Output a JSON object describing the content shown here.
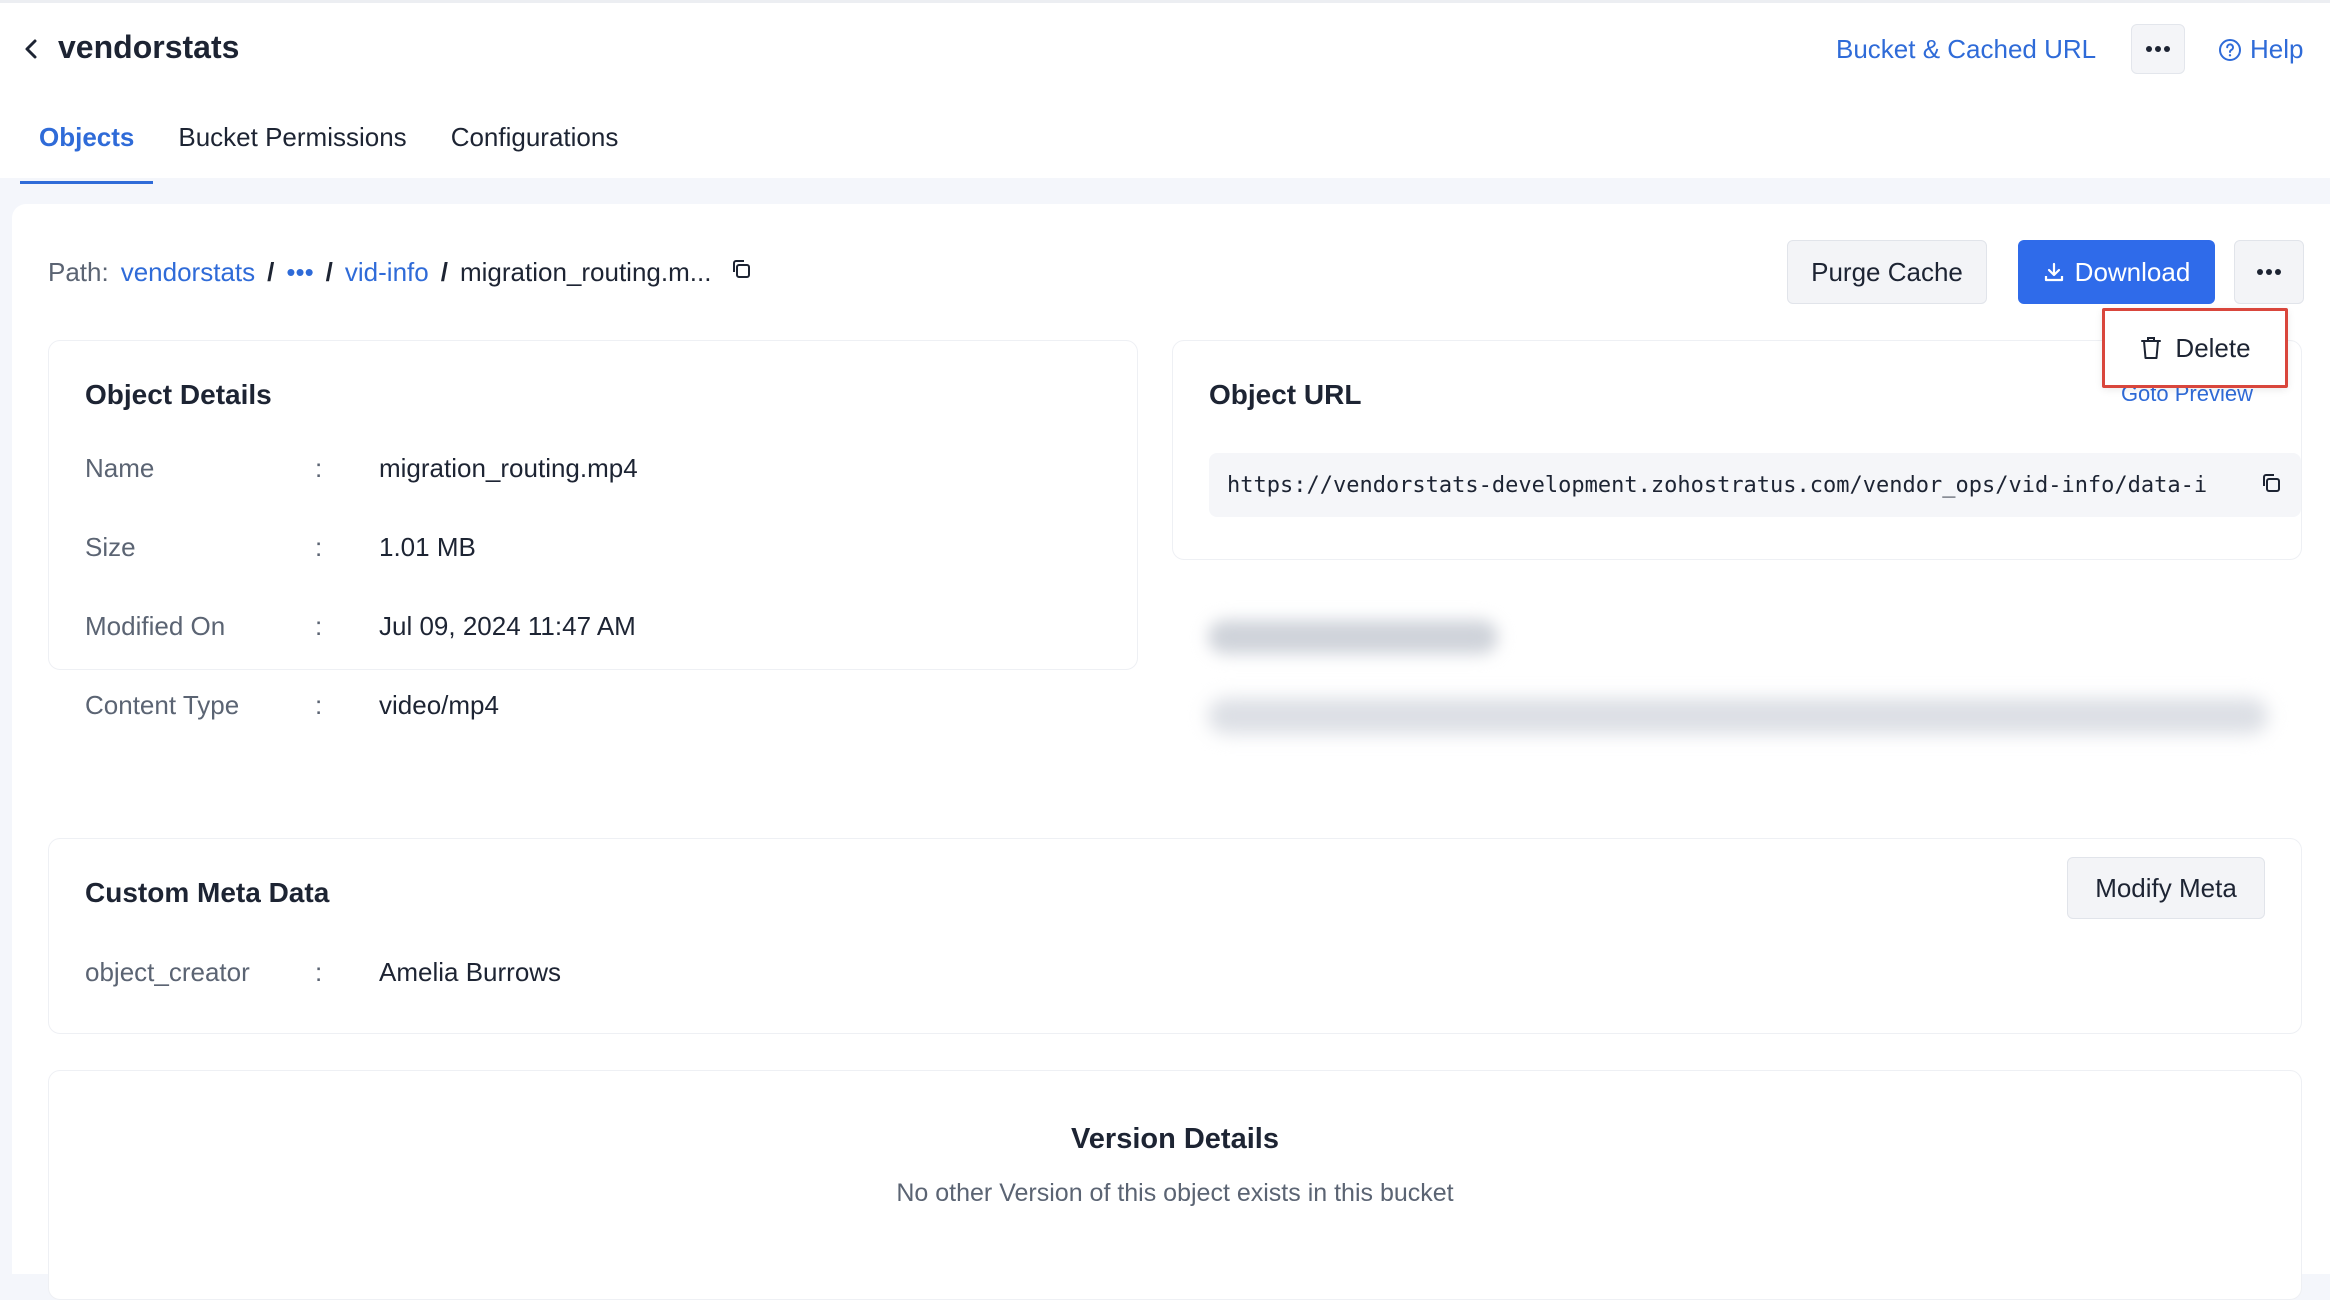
{
  "header": {
    "title": "vendorstats",
    "bucket_link": "Bucket & Cached URL",
    "help_label": "Help"
  },
  "tabs": [
    {
      "label": "Objects",
      "active": true
    },
    {
      "label": "Bucket Permissions",
      "active": false
    },
    {
      "label": "Configurations",
      "active": false
    }
  ],
  "path": {
    "label": "Path:",
    "root": "vendorstats",
    "ellipsis": "•••",
    "folder": "vid-info",
    "file": "migration_routing.m..."
  },
  "actions": {
    "purge_label": "Purge Cache",
    "download_label": "Download",
    "delete_label": "Delete"
  },
  "object_details": {
    "title": "Object Details",
    "rows": [
      {
        "key": "Name",
        "value": "migration_routing.mp4"
      },
      {
        "key": "Size",
        "value": "1.01 MB"
      },
      {
        "key": "Modified On",
        "value": "Jul 09, 2024 11:47 AM"
      },
      {
        "key": "Content Type",
        "value": "video/mp4"
      }
    ]
  },
  "object_url": {
    "title": "Object URL",
    "goto_preview": "Goto Preview",
    "url": "https://vendorstats-development.zohostratus.com/vendor_ops/vid-info/data-ir"
  },
  "custom_meta": {
    "title": "Custom Meta Data",
    "modify_label": "Modify Meta",
    "rows": [
      {
        "key": "object_creator",
        "value": "Amelia Burrows"
      }
    ]
  },
  "version": {
    "title": "Version Details",
    "message": "No other Version of this object exists in this bucket"
  },
  "separator": ":",
  "colors": {
    "accent": "#2f6bd8",
    "primary_button": "#2f6bea",
    "highlight_border": "#d9463c"
  }
}
